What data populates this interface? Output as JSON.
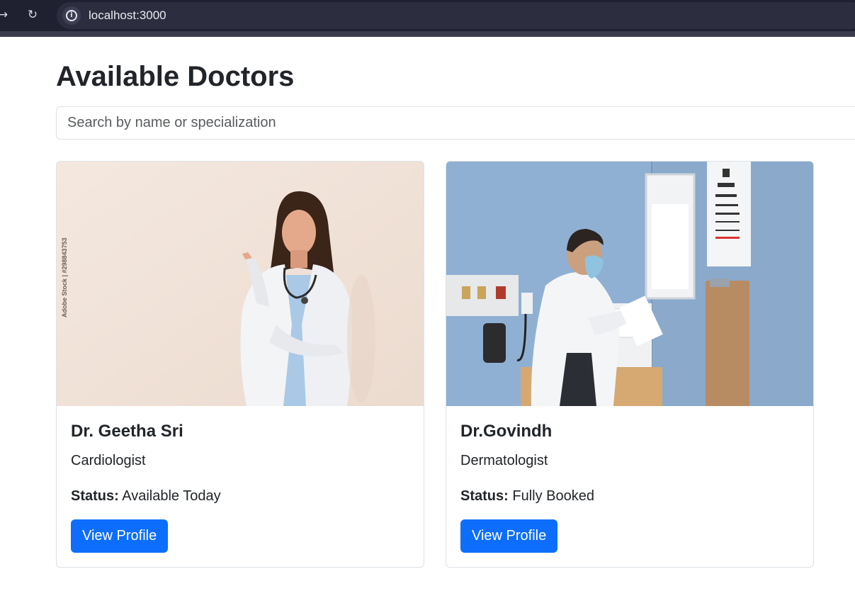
{
  "browser": {
    "url": "localhost:3000"
  },
  "page": {
    "title": "Available Doctors",
    "search": {
      "placeholder": "Search by name or specialization",
      "value": ""
    }
  },
  "doctors": [
    {
      "name": "Dr. Geetha Sri",
      "specialization": "Cardiologist",
      "status_label": "Status:",
      "status": "Available Today",
      "button_label": "View Profile",
      "image_watermark": "Adobe Stock | #298843753"
    },
    {
      "name": "Dr.Govindh",
      "specialization": "Dermatologist",
      "status_label": "Status:",
      "status": "Fully Booked",
      "button_label": "View Profile"
    }
  ],
  "colors": {
    "primary_button": "#0d6efd",
    "browser_bar": "#1f2030",
    "card_border": "#dee2e6"
  },
  "icons": [
    "forward-icon",
    "reload-icon",
    "site-info-icon"
  ]
}
